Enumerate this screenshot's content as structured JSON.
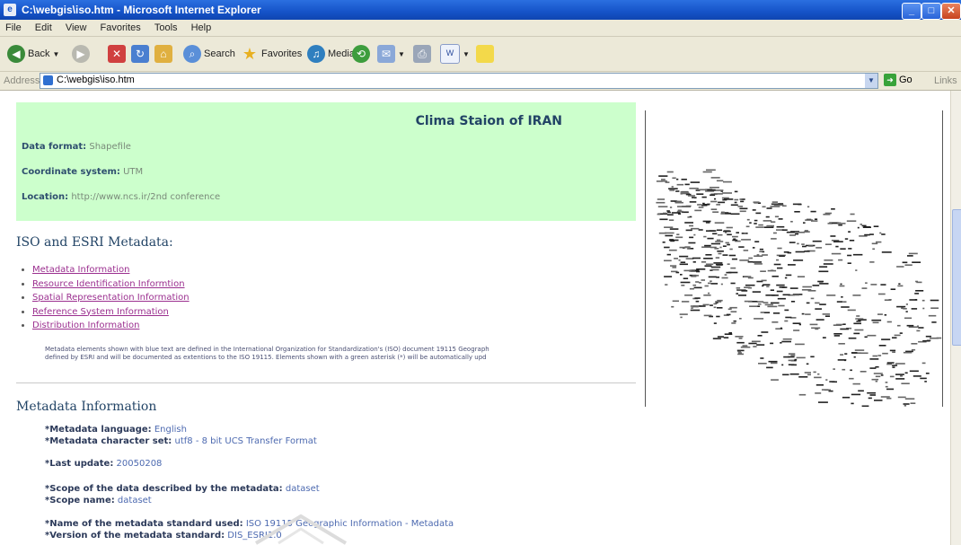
{
  "window": {
    "title": "C:\\webgis\\iso.htm - Microsoft Internet Explorer",
    "buttons": {
      "minimize": "_",
      "maximize": "□",
      "close": "✕"
    }
  },
  "menu": [
    "File",
    "Edit",
    "View",
    "Favorites",
    "Tools",
    "Help"
  ],
  "toolbar": {
    "back_label": "Back",
    "search_label": "Search",
    "favorites_label": "Favorites",
    "media_label": "Media",
    "word_label": "W"
  },
  "address": {
    "label": "Address",
    "value": "C:\\webgis\\iso.htm",
    "go_label": "Go",
    "links_label": "Links"
  },
  "page": {
    "heading": "Clima Staion of IRAN",
    "fields": [
      {
        "label": "Data format:",
        "value": "Shapefile"
      },
      {
        "label": "Coordinate system:",
        "value": "UTM"
      },
      {
        "label": "Location:",
        "value": "http://www.ncs.ir/2nd conference"
      }
    ],
    "section_title": "ISO and ESRI Metadata:",
    "links": [
      {
        "text": "Metadata Information"
      },
      {
        "text": "Resource Identification Informtion"
      },
      {
        "text": "Spatial Representation Information"
      },
      {
        "text": "Reference System Information"
      },
      {
        "text": "Distribution Information"
      }
    ],
    "note_line1": "Metadata elements shown with blue text are defined in the International Organization for Standardization's (ISO) document 19115 Geograph",
    "note_line2": "defined by ESRI and will be documented as extentions to the ISO 19115. Elements shown with a green asterisk (*) will be automatically upd",
    "metadata_title": "Metadata Information",
    "metadata_items": [
      {
        "star": "*",
        "label": "Metadata language:",
        "value": "English"
      },
      {
        "star": "*",
        "label": "Metadata character set:",
        "value": "utf8 - 8 bit UCS Transfer Format"
      },
      {
        "star": "*",
        "label": "Last update:",
        "value": "20050208"
      },
      {
        "star": "*",
        "label": "Scope of the data described by the metadata:",
        "value": "dataset"
      },
      {
        "star": "*",
        "label": "Scope name:",
        "value": "dataset"
      },
      {
        "star": "*",
        "label": "Name of the metadata standard used:",
        "value": "ISO 19115 Geographic Information - Metadata"
      },
      {
        "star": "*",
        "label": "Version of the metadata standard:",
        "value": "DIS_ESRI1.0"
      }
    ]
  },
  "colors": {
    "green_box": "#ccffcc",
    "link": "#9b2f8f",
    "heading": "#224466",
    "meta_value": "#4d6ab0"
  }
}
